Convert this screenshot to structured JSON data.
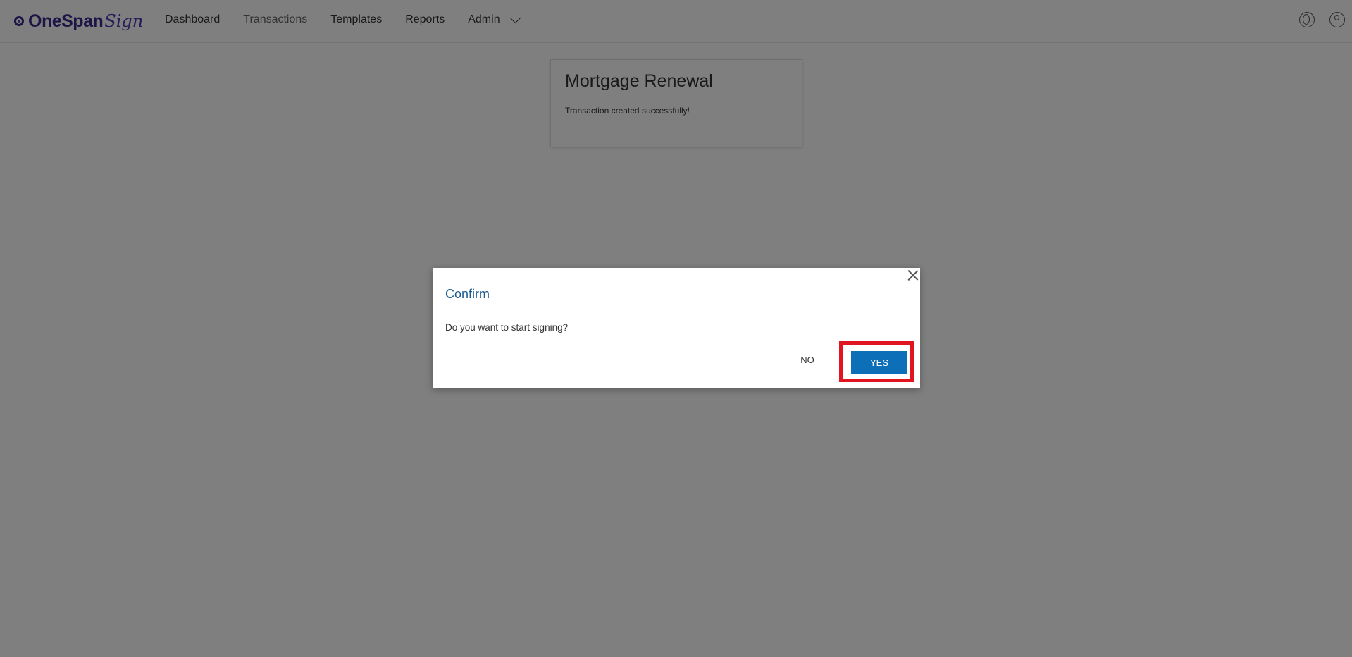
{
  "brand": {
    "name": "OneSpan",
    "script": "Sign"
  },
  "nav": {
    "items": [
      {
        "label": "Dashboard"
      },
      {
        "label": "Transactions"
      },
      {
        "label": "Templates"
      },
      {
        "label": "Reports"
      },
      {
        "label": "Admin"
      }
    ],
    "active": "Transactions"
  },
  "card": {
    "title": "Mortgage Renewal",
    "message": "Transaction created successfully!"
  },
  "dialog": {
    "title": "Confirm",
    "message": "Do you want to start signing?",
    "no_label": "NO",
    "yes_label": "YES"
  },
  "colors": {
    "brand": "#3a2b8c",
    "dialog_title": "#1c5b8f",
    "primary_button": "#0d6fb8",
    "highlight": "#e0151f"
  },
  "icons": {
    "globe": "globe-icon",
    "user": "user-icon",
    "close": "close-icon",
    "dropdown": "chevron-down-icon"
  }
}
